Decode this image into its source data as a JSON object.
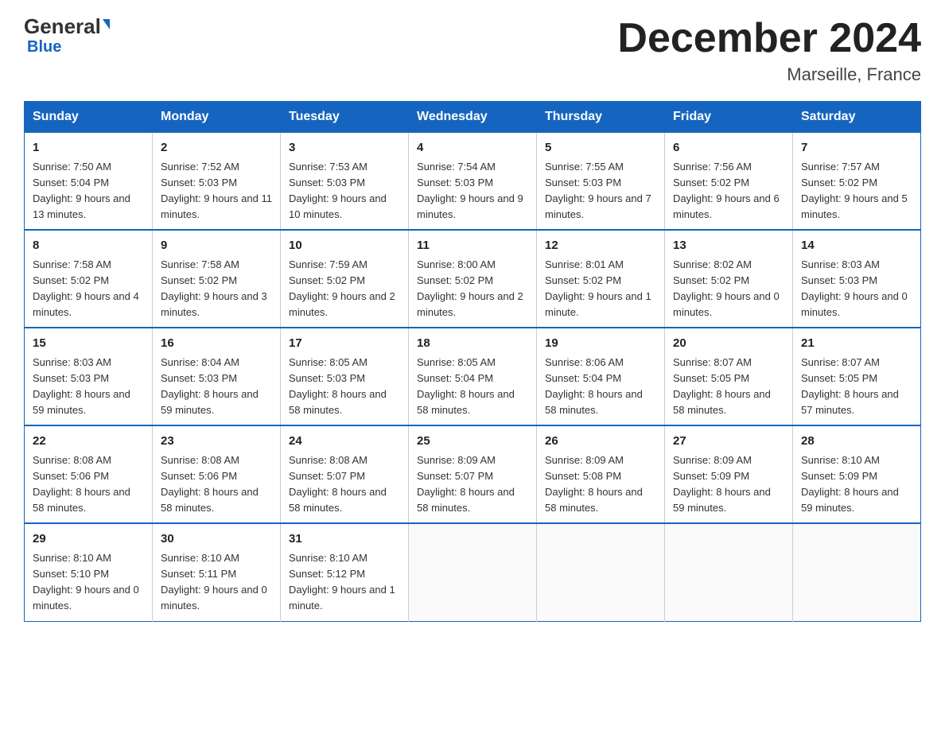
{
  "header": {
    "logo_general": "General",
    "logo_blue": "Blue",
    "month_title": "December 2024",
    "location": "Marseille, France"
  },
  "days_of_week": [
    "Sunday",
    "Monday",
    "Tuesday",
    "Wednesday",
    "Thursday",
    "Friday",
    "Saturday"
  ],
  "weeks": [
    [
      {
        "day": "1",
        "sunrise": "7:50 AM",
        "sunset": "5:04 PM",
        "daylight": "9 hours and 13 minutes."
      },
      {
        "day": "2",
        "sunrise": "7:52 AM",
        "sunset": "5:03 PM",
        "daylight": "9 hours and 11 minutes."
      },
      {
        "day": "3",
        "sunrise": "7:53 AM",
        "sunset": "5:03 PM",
        "daylight": "9 hours and 10 minutes."
      },
      {
        "day": "4",
        "sunrise": "7:54 AM",
        "sunset": "5:03 PM",
        "daylight": "9 hours and 9 minutes."
      },
      {
        "day": "5",
        "sunrise": "7:55 AM",
        "sunset": "5:03 PM",
        "daylight": "9 hours and 7 minutes."
      },
      {
        "day": "6",
        "sunrise": "7:56 AM",
        "sunset": "5:02 PM",
        "daylight": "9 hours and 6 minutes."
      },
      {
        "day": "7",
        "sunrise": "7:57 AM",
        "sunset": "5:02 PM",
        "daylight": "9 hours and 5 minutes."
      }
    ],
    [
      {
        "day": "8",
        "sunrise": "7:58 AM",
        "sunset": "5:02 PM",
        "daylight": "9 hours and 4 minutes."
      },
      {
        "day": "9",
        "sunrise": "7:58 AM",
        "sunset": "5:02 PM",
        "daylight": "9 hours and 3 minutes."
      },
      {
        "day": "10",
        "sunrise": "7:59 AM",
        "sunset": "5:02 PM",
        "daylight": "9 hours and 2 minutes."
      },
      {
        "day": "11",
        "sunrise": "8:00 AM",
        "sunset": "5:02 PM",
        "daylight": "9 hours and 2 minutes."
      },
      {
        "day": "12",
        "sunrise": "8:01 AM",
        "sunset": "5:02 PM",
        "daylight": "9 hours and 1 minute."
      },
      {
        "day": "13",
        "sunrise": "8:02 AM",
        "sunset": "5:02 PM",
        "daylight": "9 hours and 0 minutes."
      },
      {
        "day": "14",
        "sunrise": "8:03 AM",
        "sunset": "5:03 PM",
        "daylight": "9 hours and 0 minutes."
      }
    ],
    [
      {
        "day": "15",
        "sunrise": "8:03 AM",
        "sunset": "5:03 PM",
        "daylight": "8 hours and 59 minutes."
      },
      {
        "day": "16",
        "sunrise": "8:04 AM",
        "sunset": "5:03 PM",
        "daylight": "8 hours and 59 minutes."
      },
      {
        "day": "17",
        "sunrise": "8:05 AM",
        "sunset": "5:03 PM",
        "daylight": "8 hours and 58 minutes."
      },
      {
        "day": "18",
        "sunrise": "8:05 AM",
        "sunset": "5:04 PM",
        "daylight": "8 hours and 58 minutes."
      },
      {
        "day": "19",
        "sunrise": "8:06 AM",
        "sunset": "5:04 PM",
        "daylight": "8 hours and 58 minutes."
      },
      {
        "day": "20",
        "sunrise": "8:07 AM",
        "sunset": "5:05 PM",
        "daylight": "8 hours and 58 minutes."
      },
      {
        "day": "21",
        "sunrise": "8:07 AM",
        "sunset": "5:05 PM",
        "daylight": "8 hours and 57 minutes."
      }
    ],
    [
      {
        "day": "22",
        "sunrise": "8:08 AM",
        "sunset": "5:06 PM",
        "daylight": "8 hours and 58 minutes."
      },
      {
        "day": "23",
        "sunrise": "8:08 AM",
        "sunset": "5:06 PM",
        "daylight": "8 hours and 58 minutes."
      },
      {
        "day": "24",
        "sunrise": "8:08 AM",
        "sunset": "5:07 PM",
        "daylight": "8 hours and 58 minutes."
      },
      {
        "day": "25",
        "sunrise": "8:09 AM",
        "sunset": "5:07 PM",
        "daylight": "8 hours and 58 minutes."
      },
      {
        "day": "26",
        "sunrise": "8:09 AM",
        "sunset": "5:08 PM",
        "daylight": "8 hours and 58 minutes."
      },
      {
        "day": "27",
        "sunrise": "8:09 AM",
        "sunset": "5:09 PM",
        "daylight": "8 hours and 59 minutes."
      },
      {
        "day": "28",
        "sunrise": "8:10 AM",
        "sunset": "5:09 PM",
        "daylight": "8 hours and 59 minutes."
      }
    ],
    [
      {
        "day": "29",
        "sunrise": "8:10 AM",
        "sunset": "5:10 PM",
        "daylight": "9 hours and 0 minutes."
      },
      {
        "day": "30",
        "sunrise": "8:10 AM",
        "sunset": "5:11 PM",
        "daylight": "9 hours and 0 minutes."
      },
      {
        "day": "31",
        "sunrise": "8:10 AM",
        "sunset": "5:12 PM",
        "daylight": "9 hours and 1 minute."
      },
      null,
      null,
      null,
      null
    ]
  ],
  "labels": {
    "sunrise": "Sunrise:",
    "sunset": "Sunset:",
    "daylight": "Daylight:"
  }
}
